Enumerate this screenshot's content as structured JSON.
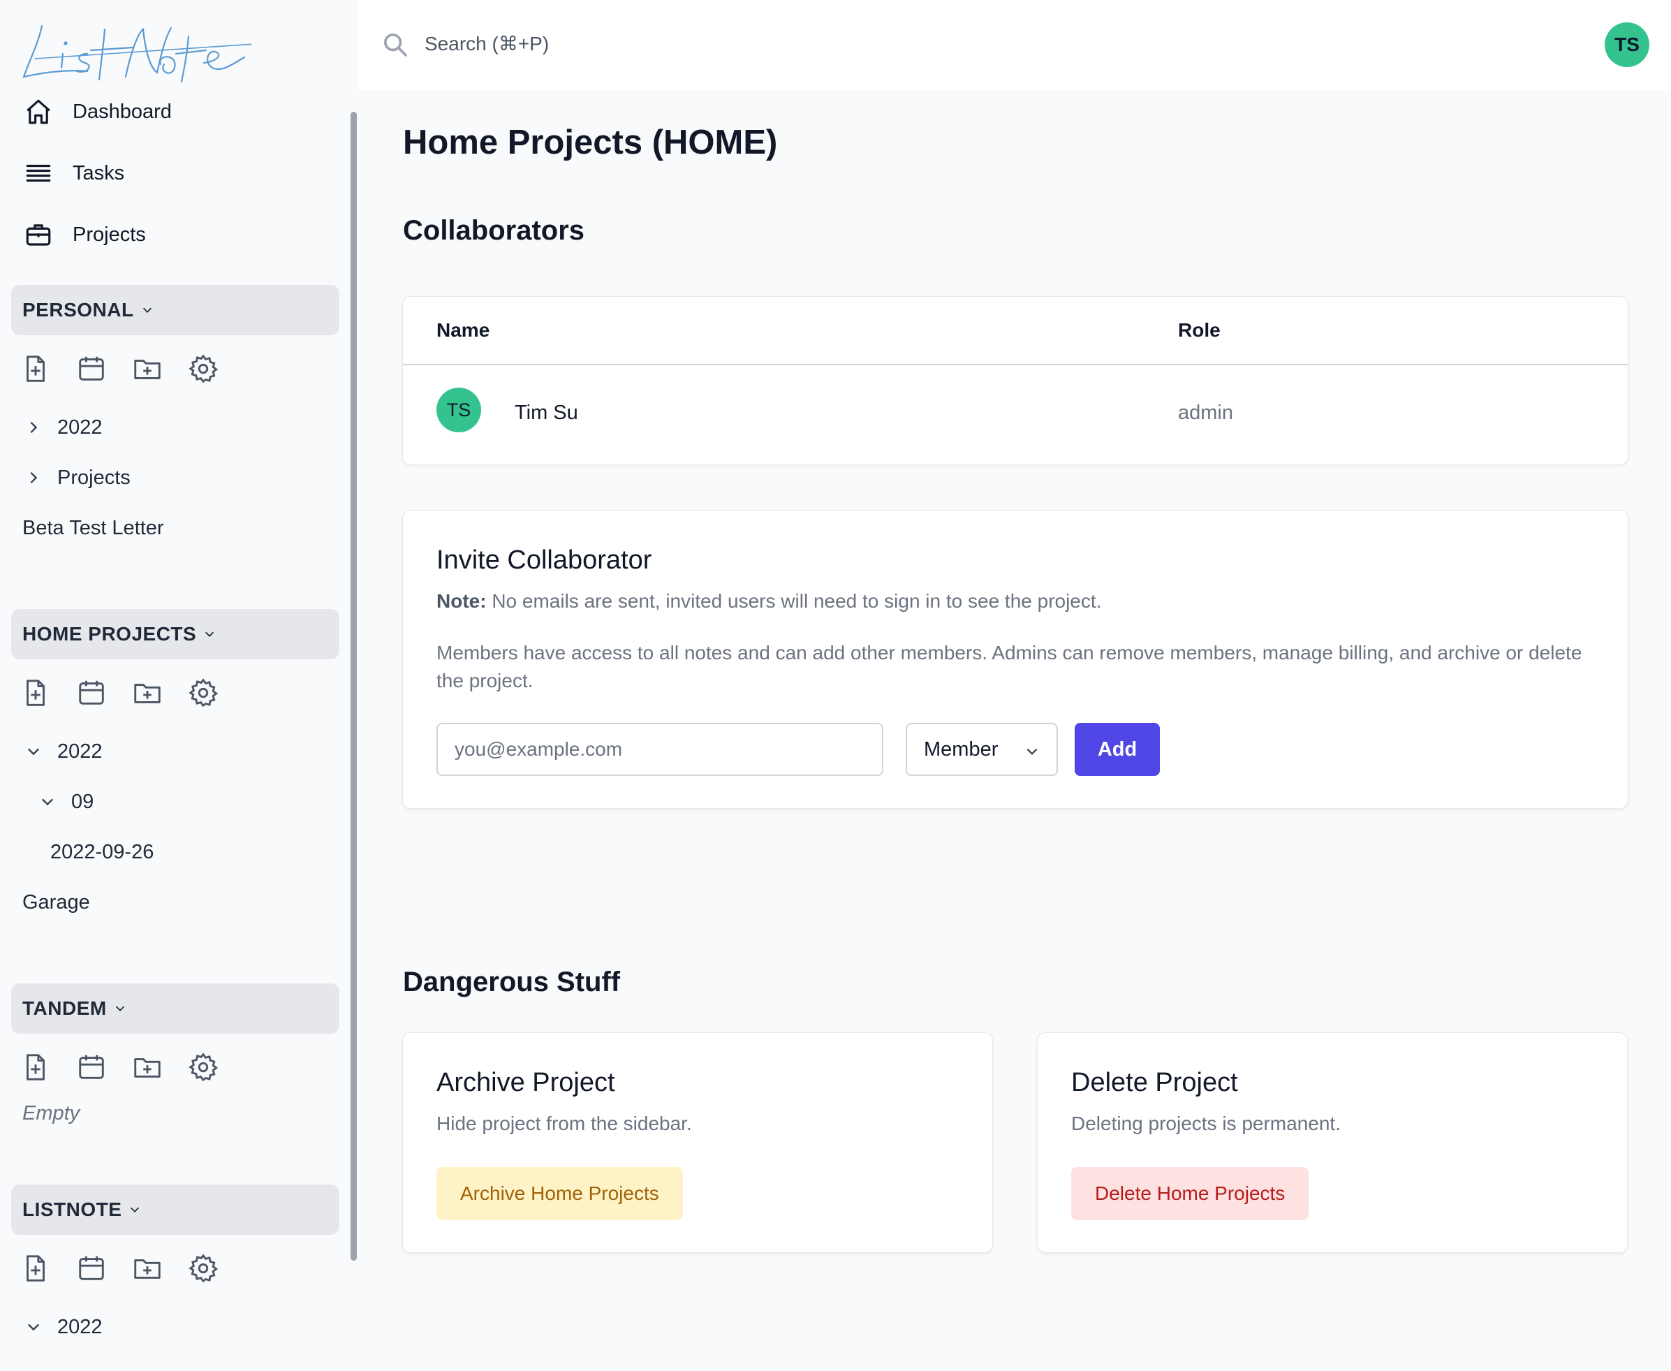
{
  "app": {
    "logo_text": "ListNote"
  },
  "topbar": {
    "search_placeholder": "Search (⌘+P)",
    "user_initials": "TS",
    "avatar_color": "#34c38f"
  },
  "sidebar": {
    "nav": [
      {
        "label": "Dashboard",
        "icon": "home-icon"
      },
      {
        "label": "Tasks",
        "icon": "list-icon"
      },
      {
        "label": "Projects",
        "icon": "briefcase-icon"
      }
    ],
    "sections": [
      {
        "name": "PERSONAL",
        "tree": [
          {
            "label": "2022"
          },
          {
            "label": "Projects"
          },
          {
            "label": "Beta Test Letter"
          }
        ]
      },
      {
        "name": "HOME PROJECTS",
        "tree": [
          {
            "label": "2022"
          },
          {
            "label": "09"
          },
          {
            "label": "2022-09-26"
          },
          {
            "label": "Garage"
          }
        ]
      },
      {
        "name": "TANDEM",
        "empty_label": "Empty"
      },
      {
        "name": "LISTNOTE",
        "tree": [
          {
            "label": "2022"
          }
        ]
      }
    ],
    "tool_icons": [
      "new-note-icon",
      "calendar-icon",
      "new-folder-icon",
      "settings-icon"
    ]
  },
  "main": {
    "title": "Home Projects (HOME)",
    "collaborators": {
      "heading": "Collaborators",
      "columns": [
        "Name",
        "Role"
      ],
      "rows": [
        {
          "initials": "TS",
          "name": "Tim Su",
          "role": "admin"
        }
      ]
    },
    "invite": {
      "title": "Invite Collaborator",
      "note_label": "Note:",
      "note_text": " No emails are sent, invited users will need to sign in to see the project.",
      "description": "Members have access to all notes and can add other members. Admins can remove members, manage billing, and archive or delete the project.",
      "email_placeholder": "you@example.com",
      "role_selected": "Member",
      "add_label": "Add",
      "add_color": "#4f46e5"
    },
    "danger": {
      "heading": "Dangerous Stuff",
      "archive": {
        "title": "Archive Project",
        "description": "Hide project from the sidebar.",
        "button": "Archive Home Projects"
      },
      "delete": {
        "title": "Delete Project",
        "description": "Deleting projects is permanent.",
        "button": "Delete Home Projects"
      }
    }
  }
}
